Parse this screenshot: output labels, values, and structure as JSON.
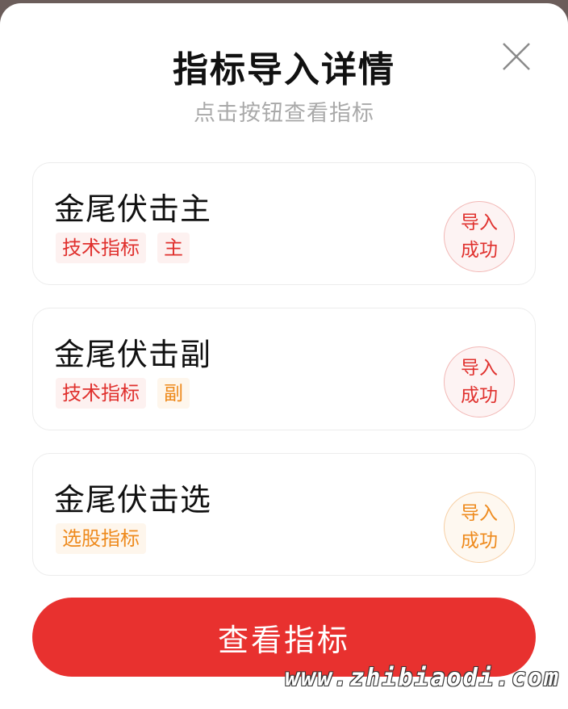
{
  "dialog": {
    "title": "指标导入详情",
    "subtitle": "点击按钮查看指标",
    "close_icon": "close-icon"
  },
  "cards": [
    {
      "name": "金尾伏击主",
      "tags": [
        {
          "label": "技术指标",
          "color": "red"
        },
        {
          "label": "主",
          "color": "red"
        }
      ],
      "status": [
        "导入",
        "成功"
      ],
      "status_color": "red"
    },
    {
      "name": "金尾伏击副",
      "tags": [
        {
          "label": "技术指标",
          "color": "red"
        },
        {
          "label": "副",
          "color": "orange"
        }
      ],
      "status": [
        "导入",
        "成功"
      ],
      "status_color": "red"
    },
    {
      "name": "金尾伏击选",
      "tags": [
        {
          "label": "选股指标",
          "color": "orange"
        }
      ],
      "status": [
        "导入",
        "成功"
      ],
      "status_color": "orange"
    }
  ],
  "button": {
    "label": "查看指标"
  },
  "watermark": "www.zhibiaodi.com",
  "colors": {
    "accent": "#e8312f",
    "tag_red": "#e0312e",
    "tag_orange": "#ee8a1d"
  }
}
